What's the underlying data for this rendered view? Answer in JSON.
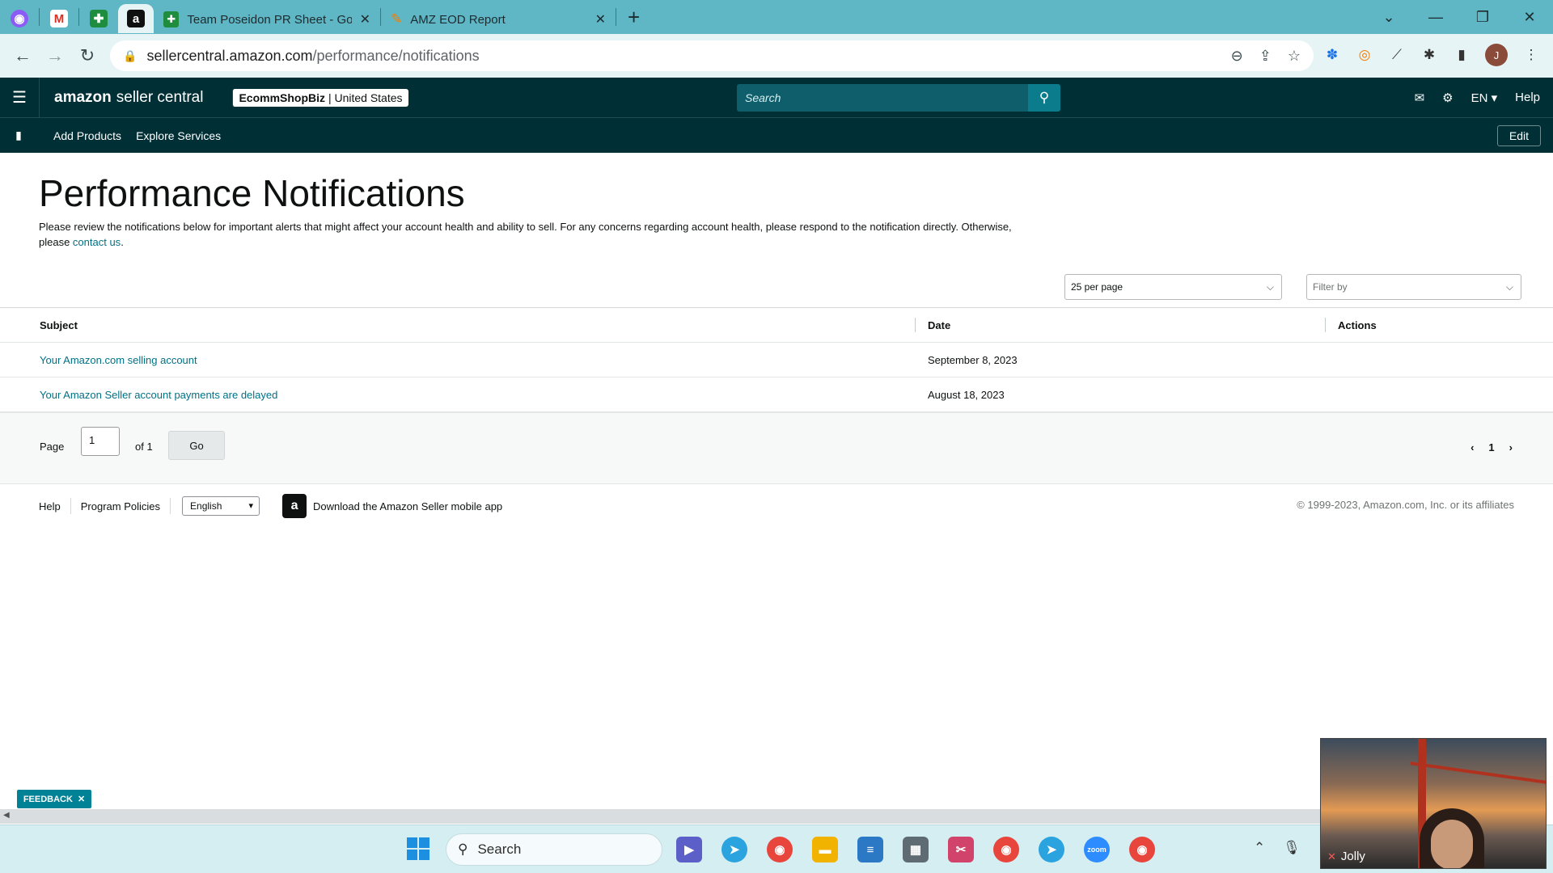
{
  "browser": {
    "tabs": [
      {
        "title": "Team Poseidon PR Sheet - Goog",
        "active": false
      },
      {
        "title": "AMZ EOD Report",
        "active": false
      }
    ],
    "pinned_icons": [
      "messenger-icon",
      "gmail-icon",
      "sheets-icon",
      "amazon-icon"
    ],
    "url_host": "sellercentral.amazon.com",
    "url_path": "/performance/notifications"
  },
  "header": {
    "brand_amazon": "amazon",
    "brand_product": "seller central",
    "store_name": "EcommShopBiz",
    "store_region": "| United States",
    "search_placeholder": "Search",
    "language": "EN",
    "help": "Help"
  },
  "nav": {
    "links": [
      "Add Products",
      "Explore Services"
    ],
    "edit_label": "Edit"
  },
  "page": {
    "title": "Performance Notifications",
    "description_before": "Please review the notifications below for important alerts that might affect your account health and ability to sell. For any concerns regarding account health, please respond to the notification directly. Otherwise, please ",
    "contact_link": "contact us",
    "description_after": "."
  },
  "controls": {
    "per_page": "25 per page",
    "filter_placeholder": "Filter by"
  },
  "table": {
    "headers": {
      "subject": "Subject",
      "date": "Date",
      "actions": "Actions"
    },
    "rows": [
      {
        "subject": "Your Amazon.com selling account",
        "date": "September 8, 2023"
      },
      {
        "subject": "Your Amazon Seller account payments are delayed",
        "date": "August 18, 2023"
      }
    ]
  },
  "pagination": {
    "page_label": "Page",
    "current_page": "1",
    "of_label": "of 1",
    "go_label": "Go",
    "nav_current": "1"
  },
  "footer": {
    "help": "Help",
    "program_policies": "Program Policies",
    "language": "English",
    "app_text": "Download the Amazon Seller mobile app",
    "copyright": "© 1999-2023, Amazon.com, Inc. or its affiliates"
  },
  "feedback": "FEEDBACK",
  "taskbar": {
    "search_label": "Search"
  },
  "video": {
    "participant": "Jolly"
  },
  "colors": {
    "header_bg": "#002f36",
    "link": "#007185",
    "tab_strip": "#5fb7c5",
    "feedback": "#008296"
  }
}
